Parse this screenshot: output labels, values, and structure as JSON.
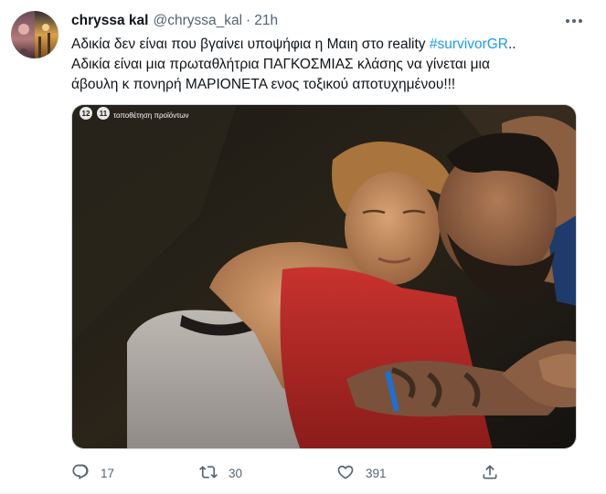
{
  "tweet": {
    "author_name": "chryssa kal",
    "author_handle": "@chryssa_kal",
    "separator": "·",
    "time": "21h",
    "text_line1_prefix": "Αδικία δεν είναι που βγαίνει υποψήφια η Μαιη στο reality ",
    "hashtag": "#survivorGR",
    "text_line1_suffix": "..",
    "text_line2": "Αδικία είναι μια πρωταθλήτρια ΠΑΓΚΟΣΜΙΑΣ κλάσης να γίνεται μια",
    "text_line3": "άβουλη κ πονηρή ΜΑΡΙΟΝΕΤΑ ενος τοξικού αποτυχημένου!!!",
    "media_overlay_text": "τοποθέτηση προϊόντων",
    "icons": {
      "avatar": "profile-avatar",
      "more": "more-icon",
      "reply": "reply-icon",
      "retweet": "retweet-icon",
      "like": "like-icon",
      "share": "share-icon"
    }
  },
  "actions": {
    "reply_count": "17",
    "retweet_count": "30",
    "like_count": "391"
  },
  "colors": {
    "link": "#1d9bf0",
    "muted": "#536471",
    "text": "#0f1419"
  }
}
